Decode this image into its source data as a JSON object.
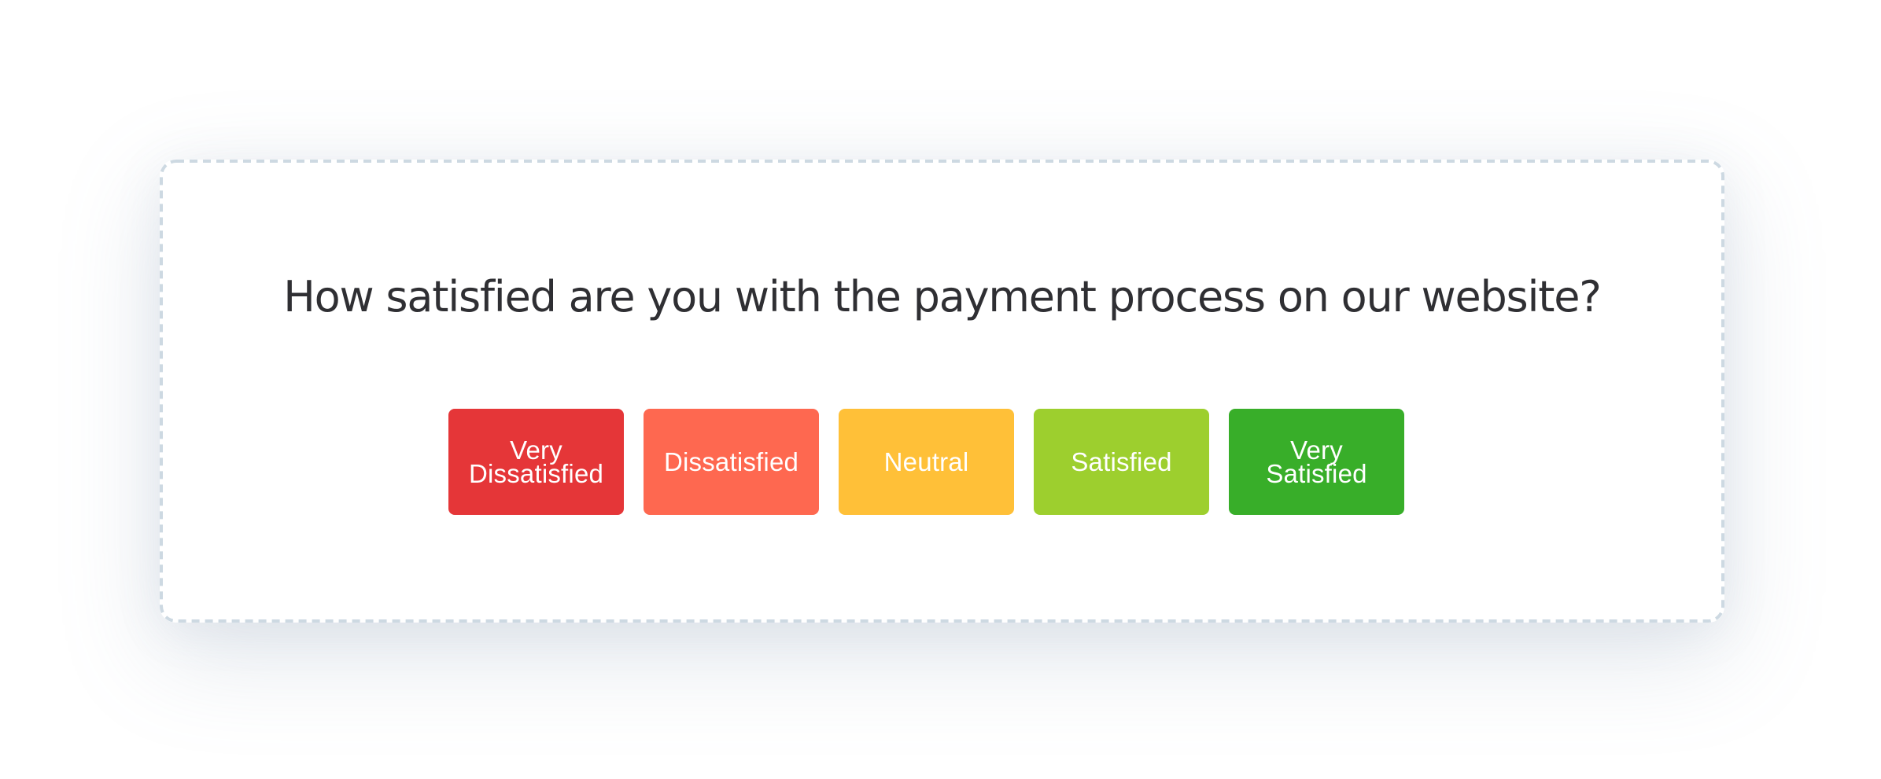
{
  "survey": {
    "question": "How satisfied are you with the payment process on our website?",
    "options": [
      {
        "label": "Very\nDissatisfied",
        "color": "#E53638"
      },
      {
        "label": "Dissatisfied",
        "color": "#FE6850"
      },
      {
        "label": "Neutral",
        "color": "#FFC038"
      },
      {
        "label": "Satisfied",
        "color": "#9DCF2E"
      },
      {
        "label": "Very\nSatisfied",
        "color": "#38AE29"
      }
    ]
  },
  "theme": {
    "card_border": "#CDD9E2",
    "question_text": "#2F2F33",
    "option_text": "#FFFFFF"
  }
}
